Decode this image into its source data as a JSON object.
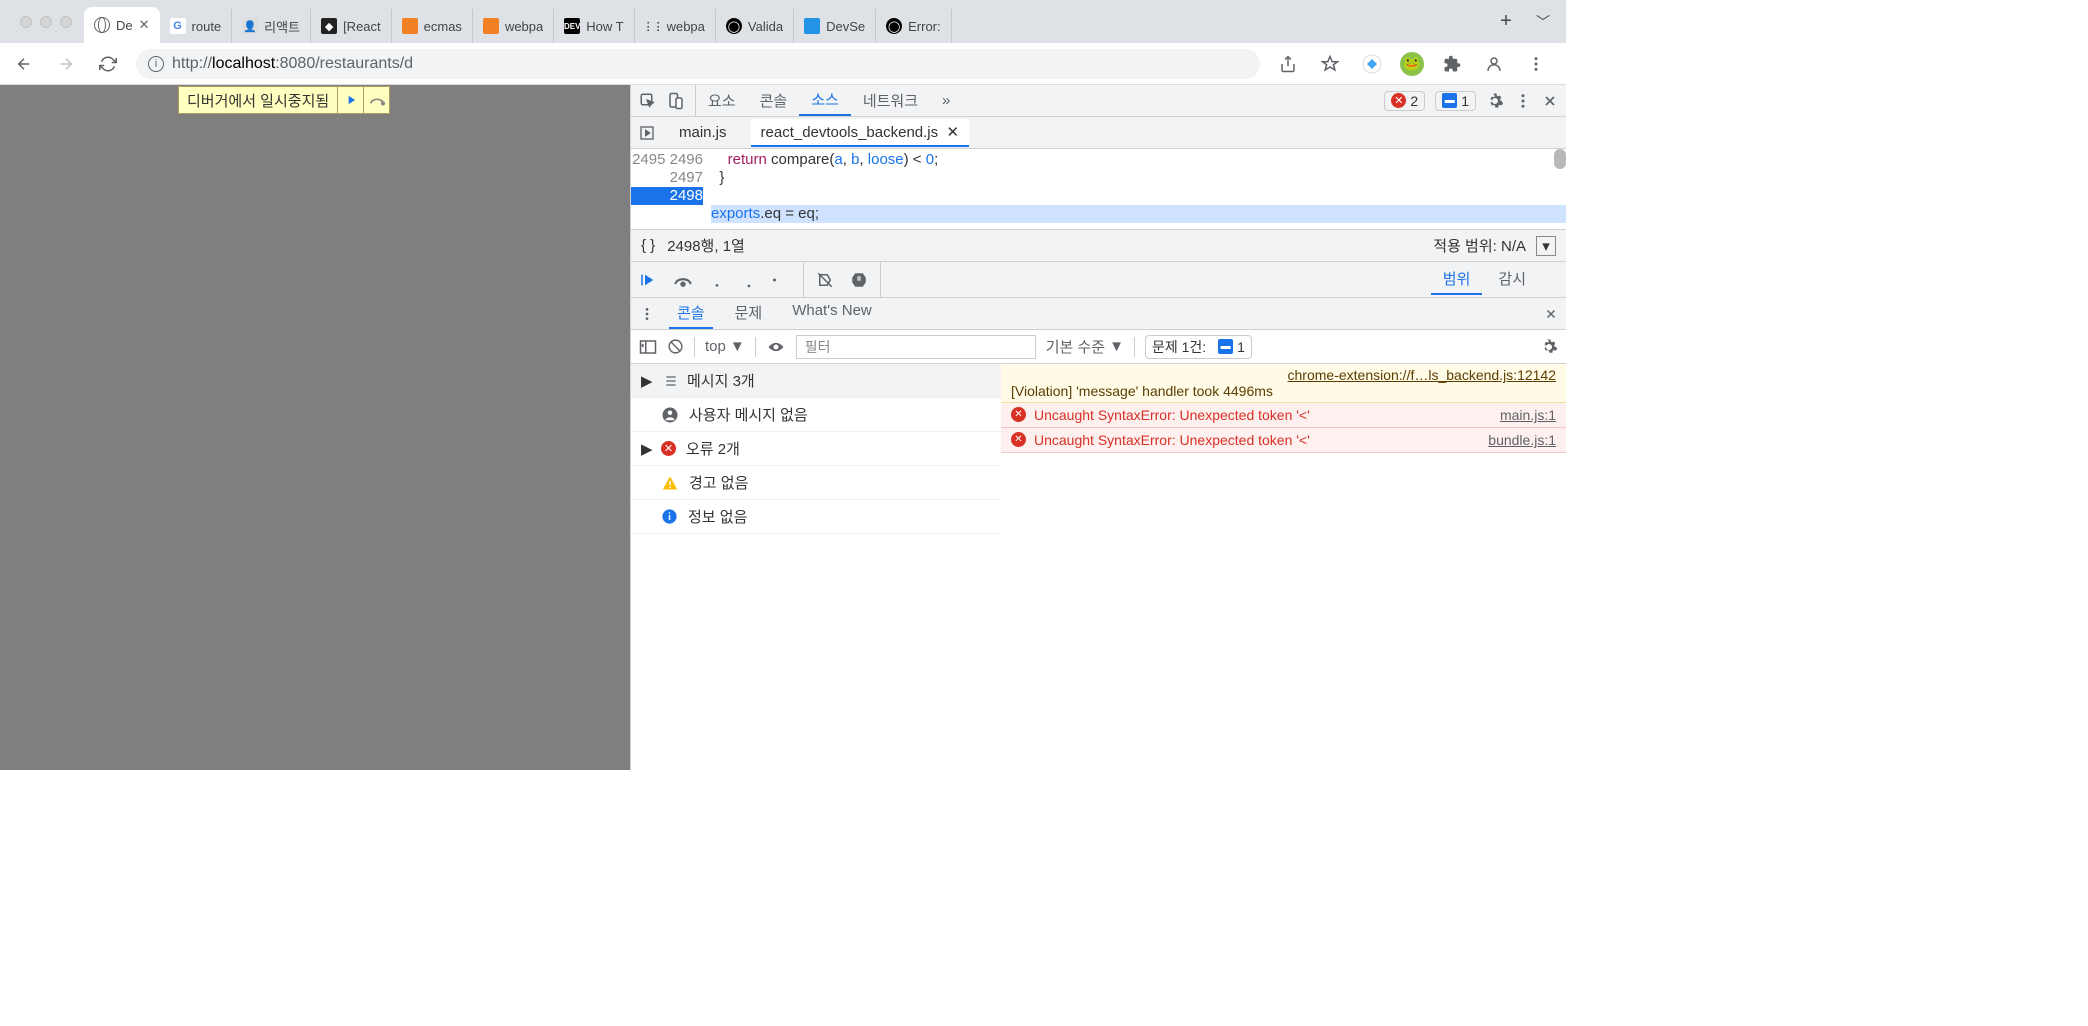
{
  "tabs": {
    "items": [
      {
        "title": "De",
        "favtype": "globe",
        "active": true
      },
      {
        "title": "route",
        "favtype": "g"
      },
      {
        "title": "리액트",
        "favtype": "img"
      },
      {
        "title": "[React",
        "favtype": "dark"
      },
      {
        "title": "ecmas",
        "favtype": "so"
      },
      {
        "title": "webpa",
        "favtype": "so"
      },
      {
        "title": "How T",
        "favtype": "dev"
      },
      {
        "title": "webpa",
        "favtype": "dots"
      },
      {
        "title": "Valida",
        "favtype": "gh"
      },
      {
        "title": "DevSe",
        "favtype": "blue"
      },
      {
        "title": "Error:",
        "favtype": "gh"
      }
    ]
  },
  "url": {
    "proto": "http://",
    "host": "localhost",
    "port": ":8080/restaurants/d"
  },
  "debugger_badge": "디버거에서 일시중지됨",
  "devtools": {
    "panels": [
      "요소",
      "콘솔",
      "소스",
      "네트워크"
    ],
    "active_panel": "소스",
    "errors": "2",
    "issues": "1",
    "source_tabs": {
      "inactive": "main.js",
      "active": "react_devtools_backend.js"
    },
    "code_lines": [
      {
        "num": "2495",
        "text_parts": [
          [
            "",
            "    "
          ],
          [
            "kw",
            "return"
          ],
          [
            "",
            " compare("
          ],
          [
            "arg",
            "a"
          ],
          [
            "",
            ", "
          ],
          [
            "arg",
            "b"
          ],
          [
            "",
            ", "
          ],
          [
            "arg",
            "loose"
          ],
          [
            "",
            ") < "
          ],
          [
            "arg",
            "0"
          ],
          [
            "",
            ";"
          ]
        ]
      },
      {
        "num": "2496",
        "text_parts": [
          [
            "",
            "  }"
          ]
        ]
      },
      {
        "num": "2497",
        "text_parts": [
          [
            "",
            ""
          ]
        ]
      },
      {
        "num": "2498",
        "hl": true,
        "text_parts": [
          [
            "arg",
            "exports"
          ],
          [
            "",
            ".eq = eq;"
          ]
        ]
      }
    ],
    "status": {
      "pos": "2498행, 1열",
      "scope": "적용 범위: N/A"
    },
    "scope_tabs": {
      "active": "범위",
      "other": "감시"
    }
  },
  "drawer": {
    "tabs": [
      "콘솔",
      "문제",
      "What's New"
    ],
    "active": "콘솔",
    "top_ctx": "top",
    "filter_placeholder": "필터",
    "level": "기본 수준",
    "issues_label": "문제 1건:",
    "issues_count": "1",
    "tree": [
      {
        "icon": "list",
        "label": "메시지 3개",
        "arrow": true,
        "hdr": true
      },
      {
        "icon": "user",
        "label": "사용자 메시지 없음"
      },
      {
        "icon": "err",
        "label": "오류 2개",
        "arrow": true
      },
      {
        "icon": "warn",
        "label": "경고 없음"
      },
      {
        "icon": "info",
        "label": "정보 없음"
      }
    ],
    "messages": [
      {
        "type": "warn",
        "link": "chrome-extension://f…ls_backend.js:12142",
        "text": "[Violation] 'message' handler took 4496ms"
      },
      {
        "type": "err",
        "text": "Uncaught SyntaxError: Unexpected token '<'",
        "src": "main.js:1"
      },
      {
        "type": "err",
        "text": "Uncaught SyntaxError: Unexpected token '<'",
        "src": "bundle.js:1"
      }
    ]
  }
}
